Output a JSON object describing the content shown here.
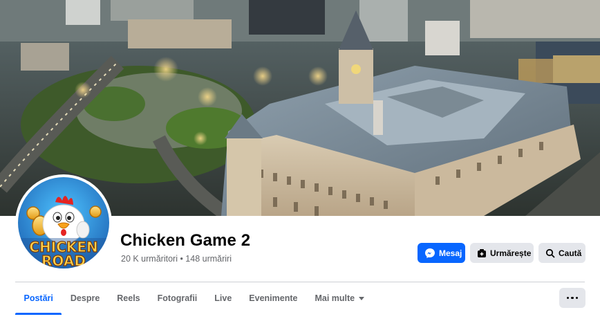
{
  "page": {
    "title": "Chicken Game 2",
    "stats": "20 K urmăritori • 148 urmăriri"
  },
  "avatar": {
    "logo_line1": "CHICKEN",
    "logo_line2": "ROAD"
  },
  "actions": {
    "message_label": "Mesaj",
    "follow_label": "Urmărește",
    "search_label": "Caută"
  },
  "tabs": [
    {
      "label": "Postări",
      "active": true
    },
    {
      "label": "Despre"
    },
    {
      "label": "Reels"
    },
    {
      "label": "Fotografii"
    },
    {
      "label": "Live"
    },
    {
      "label": "Evenimente"
    },
    {
      "label": "Mai multe"
    }
  ],
  "icons": {
    "message": "messenger-icon",
    "follow": "follow-icon",
    "search": "search-icon",
    "more": "more-dots-icon",
    "dropdown": "caret-down-icon"
  },
  "colors": {
    "accent": "#0866ff",
    "secondary_button": "#e4e6eb",
    "muted_text": "#65676b",
    "text": "#050505"
  }
}
